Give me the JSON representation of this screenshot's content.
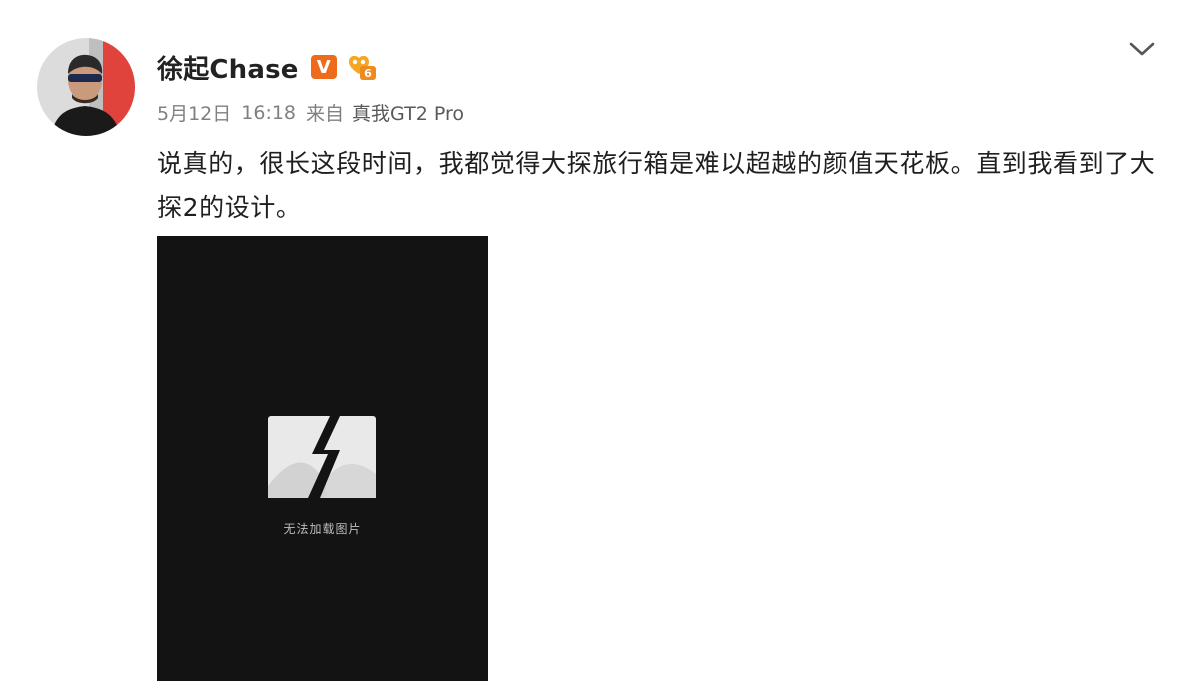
{
  "post": {
    "author": {
      "name": "徐起Chase",
      "verified_badge": "V"
    },
    "meta": {
      "date": "5月12日",
      "time": "16:18",
      "source_prefix": "来自",
      "source_device": "真我GT2 Pro"
    },
    "text": "说真的，很长这段时间，我都觉得大探旅行箱是难以超越的颜值天花板。直到我看到了大探2的设计。",
    "image": {
      "error_label": "无法加载图片"
    },
    "menu_icon": "chevron-down-icon"
  },
  "colors": {
    "verified_badge": "#ef6b1c",
    "member_badge": "#f5a623",
    "image_background": "#131313",
    "text_primary": "#1f1f1f",
    "text_meta": "#808080"
  }
}
